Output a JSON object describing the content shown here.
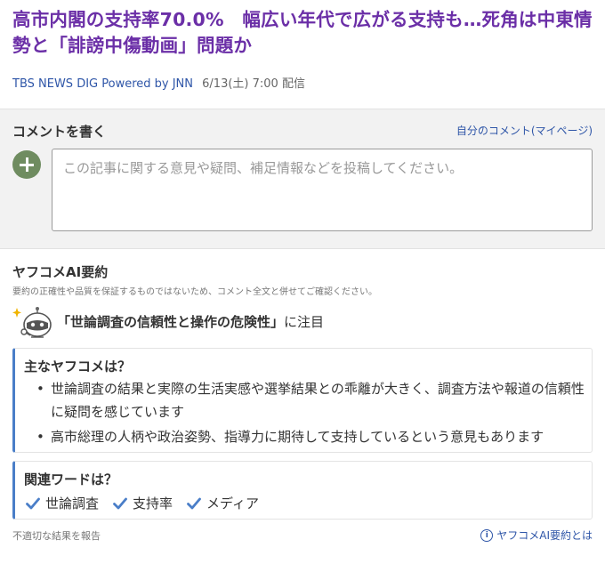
{
  "article": {
    "headline": "高市内閣の支持率70.0%　幅広い年代で広がる支持も…死角は中東情勢と「誹謗中傷動画」問題か",
    "source": "TBS NEWS DIG Powered by JNN",
    "date": "6/13(土) 7:00 配信"
  },
  "comment": {
    "title": "コメントを書く",
    "mypage_link": "自分のコメント(マイページ)",
    "placeholder": "この記事に関する意見や疑問、補足情報などを投稿してください。"
  },
  "ai_summary": {
    "title": "ヤフコメAI要約",
    "disclaimer": "要約の正確性や品質を保証するものではないため、コメント全文と併せてご確認ください。",
    "headline_quote": "「世論調査の信頼性と操作の危険性」",
    "headline_suffix": "に注目",
    "main_title": "主なヤフコメは？",
    "main_points": [
      "世論調査の結果と実際の生活実感や選挙結果との乖離が大きく、調査方法や報道の信頼性に疑問を感じています",
      "高市総理の人柄や政治姿勢、指導力に期待して支持しているという意見もあります"
    ],
    "related_title": "関連ワードは？",
    "related_words": [
      "世論調査",
      "支持率",
      "メディア"
    ],
    "report_link": "不適切な結果を報告",
    "about_link": "ヤフコメAI要約とは"
  },
  "colors": {
    "headline": "#6b2fa7",
    "link": "#2f56a8",
    "accent": "#4a7ec8",
    "avatar": "#6f8c60"
  },
  "icons": {
    "add": "plus-icon",
    "robot": "robot-icon",
    "check": "check-icon",
    "info": "info-icon"
  }
}
